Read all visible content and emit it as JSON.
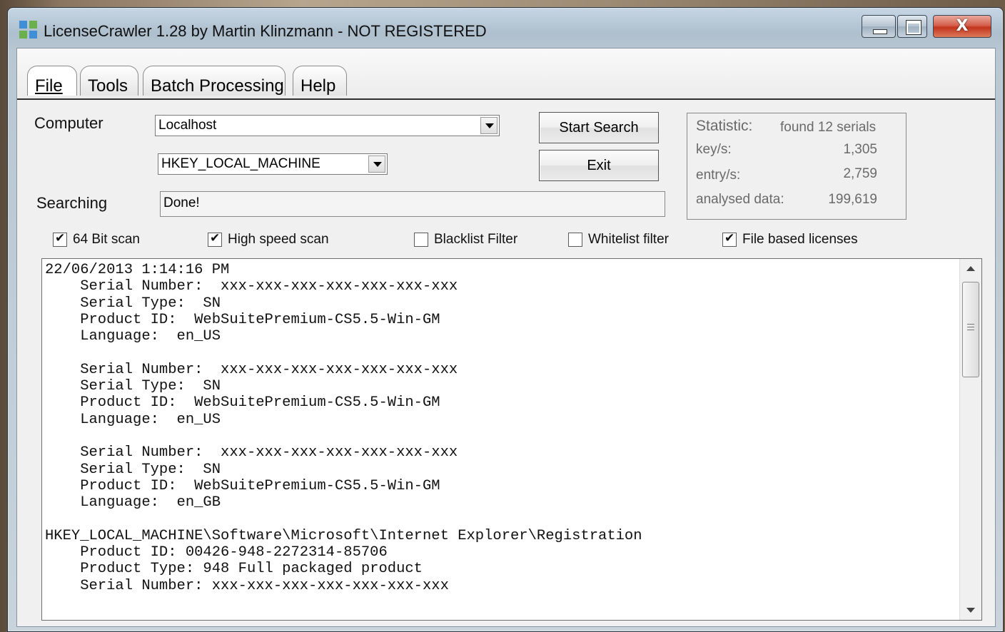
{
  "window": {
    "title": "LicenseCrawler 1.28 by Martin Klinzmann - NOT REGISTERED",
    "close_glyph": "X"
  },
  "tabs": [
    "File",
    "Tools",
    "Batch Processing",
    "Help"
  ],
  "form": {
    "computer_label": "Computer",
    "computer_value": "Localhost",
    "hive_value": "HKEY_LOCAL_MACHINE",
    "searching_label": "Searching",
    "searching_value": "Done!",
    "start_button": "Start Search",
    "exit_button": "Exit"
  },
  "statistic": {
    "title": "Statistic:",
    "found": "found 12 serials",
    "keys_label": "key/s:",
    "keys_value": "1,305",
    "entry_label": "entry/s:",
    "entry_value": "2,759",
    "data_label": "analysed data:",
    "data_value": "199,619"
  },
  "options": [
    {
      "label": "64 Bit scan",
      "checked": true
    },
    {
      "label": "High speed scan",
      "checked": true
    },
    {
      "label": "Blacklist Filter",
      "checked": false
    },
    {
      "label": "Whitelist filter",
      "checked": false
    },
    {
      "label": "File based licenses",
      "checked": true
    }
  ],
  "log_text": "22/06/2013 1:14:16 PM\n    Serial Number:  xxx-xxx-xxx-xxx-xxx-xxx-xxx\n    Serial Type:  SN\n    Product ID:  WebSuitePremium-CS5.5-Win-GM\n    Language:  en_US\n\n    Serial Number:  xxx-xxx-xxx-xxx-xxx-xxx-xxx\n    Serial Type:  SN\n    Product ID:  WebSuitePremium-CS5.5-Win-GM\n    Language:  en_US\n\n    Serial Number:  xxx-xxx-xxx-xxx-xxx-xxx-xxx\n    Serial Type:  SN\n    Product ID:  WebSuitePremium-CS5.5-Win-GM\n    Language:  en_GB\n\nHKEY_LOCAL_MACHINE\\Software\\Microsoft\\Internet Explorer\\Registration\n    Product ID: 00426-948-2272314-85706\n    Product Type: 948 Full packaged product\n    Serial Number: xxx-xxx-xxx-xxx-xxx-xxx-xxx"
}
